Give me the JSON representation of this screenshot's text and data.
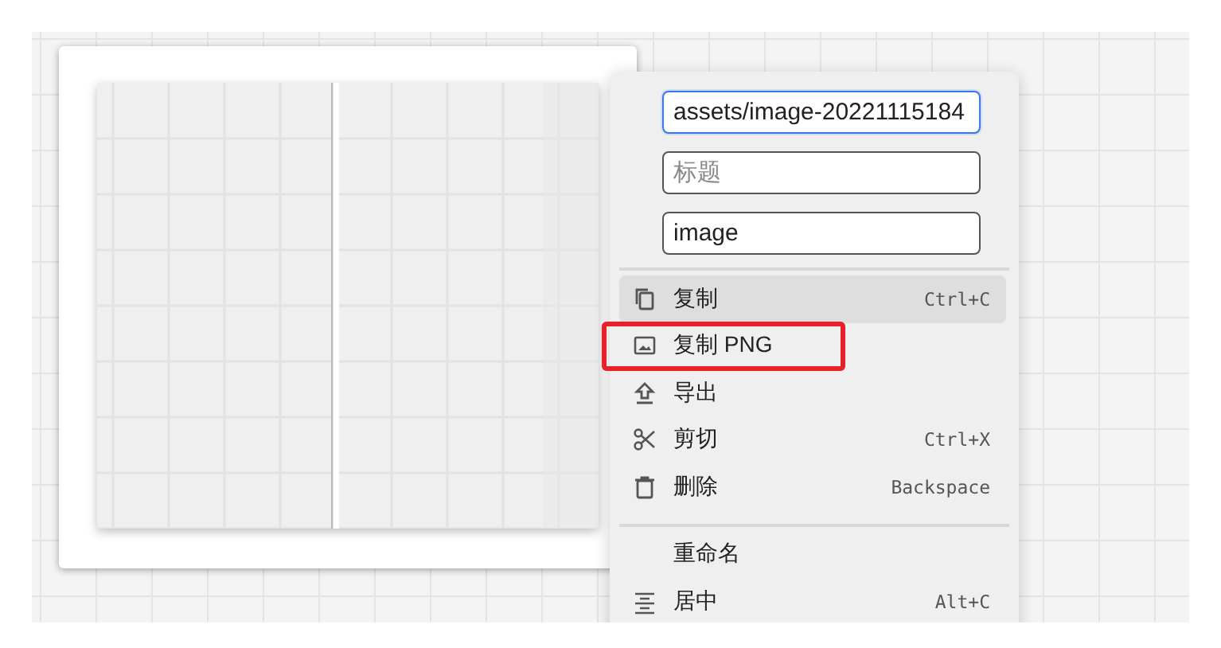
{
  "menu": {
    "fields": [
      {
        "value": "assets/image-20221115184",
        "focused": true
      },
      {
        "placeholder": "标题",
        "focused": false
      },
      {
        "value": "image",
        "focused": false
      }
    ],
    "groups": [
      [
        {
          "label": "复制",
          "shortcut": "Ctrl+C",
          "highlighted": true,
          "outlined": false
        },
        {
          "label": "复制 PNG",
          "highlighted": false,
          "outlined": true
        },
        {
          "label": "导出",
          "highlighted": false,
          "outlined": false
        },
        {
          "label": "剪切",
          "shortcut": "Ctrl+X",
          "highlighted": false,
          "outlined": false
        },
        {
          "label": "删除",
          "shortcut": "Backspace",
          "highlighted": false,
          "outlined": false
        }
      ],
      [
        {
          "label": "重命名",
          "highlighted": false,
          "outlined": false
        },
        {
          "label": "居中",
          "shortcut": "Alt+C",
          "highlighted": false,
          "outlined": false
        }
      ]
    ]
  }
}
